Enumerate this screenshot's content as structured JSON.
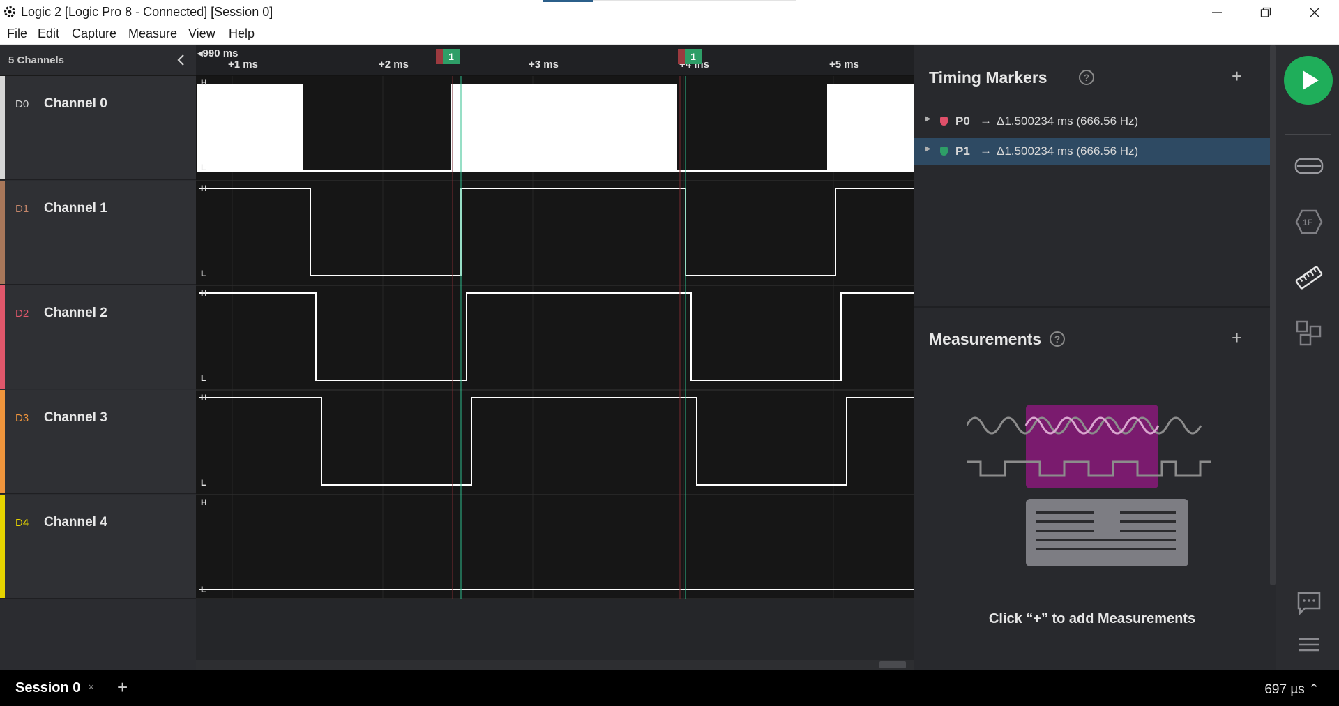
{
  "window": {
    "title": "Logic 2 [Logic Pro 8 - Connected] [Session 0]"
  },
  "menu": [
    "File",
    "Edit",
    "Capture",
    "Measure",
    "View",
    "Help"
  ],
  "channels": {
    "header": "5 Channels",
    "items": [
      {
        "code": "D0",
        "name": "Channel 0",
        "color": "#d6d6d6"
      },
      {
        "code": "D1",
        "name": "Channel 1",
        "color": "#a8775a"
      },
      {
        "code": "D2",
        "name": "Channel 2",
        "color": "#e0576b"
      },
      {
        "code": "D3",
        "name": "Channel 3",
        "color": "#f0953c"
      },
      {
        "code": "D4",
        "name": "Channel 4",
        "color": "#e6d400"
      }
    ]
  },
  "ruler": {
    "start": "990 ms",
    "ticks": [
      "+1 ms",
      "+2 ms",
      "+3 ms",
      "+4 ms",
      "+5 ms"
    ],
    "marker_labels": [
      "1",
      "1"
    ]
  },
  "level_labels": {
    "high": "H",
    "low": "L"
  },
  "timing_markers": {
    "title": "Timing Markers",
    "help": "?",
    "add": "+",
    "rows": [
      {
        "name": "P0",
        "arrow": "→",
        "delta": "Δ1.500234 ms (666.56 Hz)",
        "color": "#e0506a",
        "selected": false
      },
      {
        "name": "P1",
        "arrow": "→",
        "delta": "Δ1.500234 ms (666.56 Hz)",
        "color": "#2e9e67",
        "selected": true
      }
    ]
  },
  "measurements": {
    "title": "Measurements",
    "help": "?",
    "add": "+",
    "hint": "Click “+” to add Measurements"
  },
  "toolbar_icons": [
    "play-icon",
    "analyzers-icon",
    "extensions-icon",
    "timing-ruler-icon",
    "layout-icon",
    "feedback-icon",
    "menu-icon"
  ],
  "bottom": {
    "session": "Session 0",
    "close": "×",
    "add": "+",
    "status": "697 µs ⌃"
  },
  "colors": {
    "accent_green": "#1fae5a",
    "selected_row": "#2e4a63",
    "measure_purple": "#7a1b6e"
  }
}
